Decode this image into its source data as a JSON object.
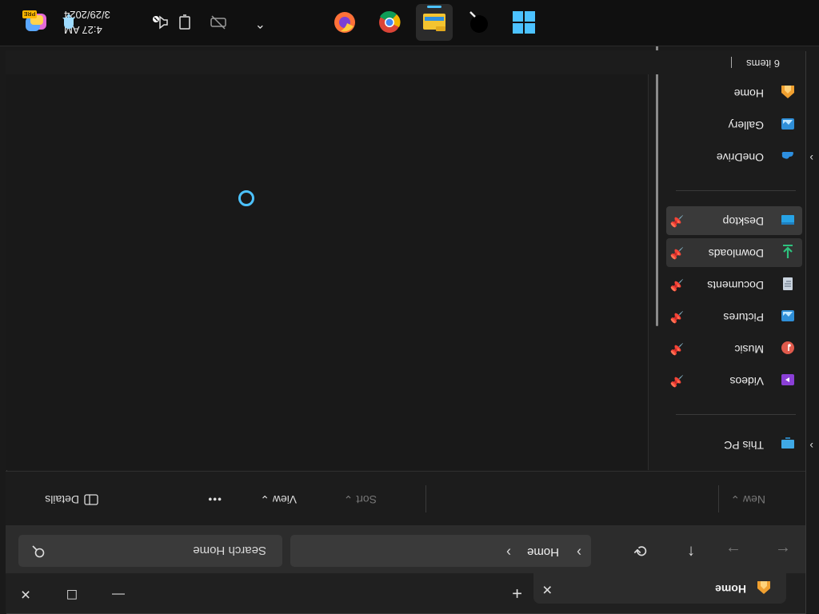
{
  "window": {
    "tab_title": "Home",
    "tab_close": "✕",
    "new_tab": "+",
    "controls": {
      "minimize": "—",
      "maximize": "☐",
      "close": "✕"
    }
  },
  "address": {
    "back": "←",
    "forward": "→",
    "up": "↑",
    "refresh": "⟳",
    "crumb_sep": "›",
    "crumb": "Home",
    "search_placeholder": "Search Home"
  },
  "toolbar": {
    "new_label": "New",
    "sort_label": "Sort",
    "view_label": "View",
    "more_label": "•••",
    "details_label": "Details",
    "caret": "⌄"
  },
  "sidebar": {
    "items": [
      {
        "label": "Home",
        "icon": "home-icon"
      },
      {
        "label": "Gallery",
        "icon": "gallery-icon"
      },
      {
        "label": "OneDrive",
        "icon": "onedrive-icon",
        "expandable": true
      },
      {
        "label": "Desktop",
        "icon": "desktop-folder-icon",
        "pinned": true,
        "selected": true
      },
      {
        "label": "Downloads",
        "icon": "downloads-folder-icon",
        "pinned": true,
        "hover": true
      },
      {
        "label": "Documents",
        "icon": "documents-folder-icon",
        "pinned": true
      },
      {
        "label": "Pictures",
        "icon": "pictures-folder-icon",
        "pinned": true
      },
      {
        "label": "Music",
        "icon": "music-folder-icon",
        "pinned": true
      },
      {
        "label": "Videos",
        "icon": "videos-folder-icon",
        "pinned": true
      },
      {
        "label": "This PC",
        "icon": "this-pc-icon",
        "expandable": true
      }
    ],
    "chevron": "›",
    "pin": "📌"
  },
  "status": {
    "item_count": "6 items"
  },
  "taskbar": {
    "apps": [
      "start-icon",
      "paint-app-icon",
      "file-explorer-icon",
      "chrome-icon",
      "firefox-icon"
    ],
    "tray_chevron": "⌃",
    "time": "4:27 AM",
    "date": "3/29/2024"
  },
  "colors": {
    "accent": "#4cc2ff",
    "background": "#1c1c1c"
  }
}
